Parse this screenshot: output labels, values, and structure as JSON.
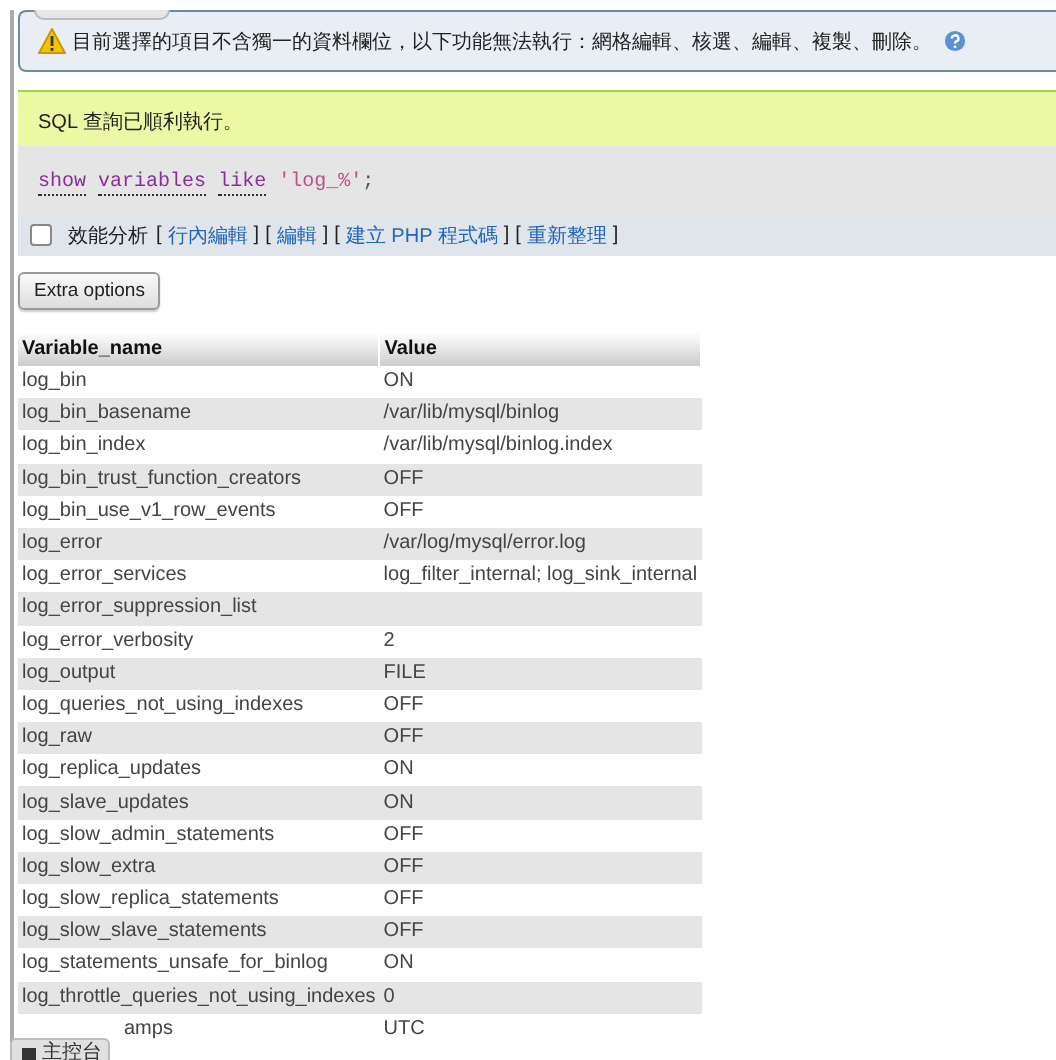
{
  "warning": {
    "text": "目前選擇的項目不含獨一的資料欄位，以下功能無法執行：網格編輯、核選、編輯、複製、刪除。"
  },
  "success": {
    "message": "SQL 查詢已順利執行。"
  },
  "sql": [
    {
      "kind": "keyword",
      "text": "show"
    },
    {
      "kind": "keyword",
      "text": "variables"
    },
    {
      "kind": "keyword",
      "text": "like"
    },
    {
      "kind": "string",
      "text": "'log_%'"
    },
    {
      "kind": "punct",
      "text": ";"
    }
  ],
  "profiling": {
    "label": "效能分析",
    "checked": false
  },
  "links": [
    {
      "open": "[",
      "label": "行內編輯",
      "close": "]"
    },
    {
      "open": "[",
      "label": "編輯",
      "close": "]"
    },
    {
      "open": "[",
      "label": "建立 PHP 程式碼",
      "close": "]"
    },
    {
      "open": "[",
      "label": "重新整理",
      "close": "]"
    }
  ],
  "extra_button": "Extra options",
  "table": {
    "columns": [
      "Variable_name",
      "Value"
    ],
    "rows": [
      [
        "log_bin",
        "ON"
      ],
      [
        "log_bin_basename",
        "/var/lib/mysql/binlog"
      ],
      [
        "log_bin_index",
        "/var/lib/mysql/binlog.index"
      ],
      [
        "log_bin_trust_function_creators",
        "OFF"
      ],
      [
        "log_bin_use_v1_row_events",
        "OFF"
      ],
      [
        "log_error",
        "/var/log/mysql/error.log"
      ],
      [
        "log_error_services",
        "log_filter_internal; log_sink_internal"
      ],
      [
        "log_error_suppression_list",
        ""
      ],
      [
        "log_error_verbosity",
        "2"
      ],
      [
        "log_output",
        "FILE"
      ],
      [
        "log_queries_not_using_indexes",
        "OFF"
      ],
      [
        "log_raw",
        "OFF"
      ],
      [
        "log_replica_updates",
        "ON"
      ],
      [
        "log_slave_updates",
        "ON"
      ],
      [
        "log_slow_admin_statements",
        "OFF"
      ],
      [
        "log_slow_extra",
        "OFF"
      ],
      [
        "log_slow_replica_statements",
        "OFF"
      ],
      [
        "log_slow_slave_statements",
        "OFF"
      ],
      [
        "log_statements_unsafe_for_binlog",
        "ON"
      ],
      [
        "log_throttle_queries_not_using_indexes",
        "0"
      ],
      [
        "amps",
        "UTC"
      ]
    ]
  },
  "console": {
    "label": "主控台"
  }
}
